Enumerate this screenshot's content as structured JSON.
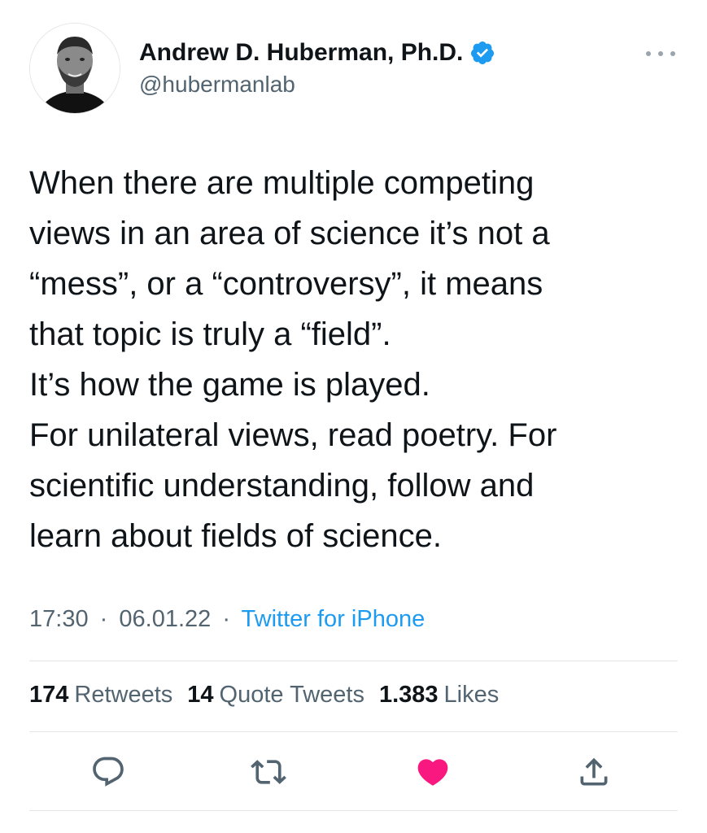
{
  "author": {
    "display_name": "Andrew D. Huberman, Ph.D.",
    "handle": "@hubermanlab",
    "verified": true
  },
  "tweet": {
    "lines": [
      "When there are multiple competing",
      "views in an area of science it’s not a",
      "“mess”, or a “controversy”, it means",
      "that topic is truly a “field”.",
      "It’s how the game is played.",
      "For unilateral views, read poetry. For",
      "scientific understanding, follow and",
      "learn about fields of science."
    ],
    "time": "17:30",
    "date": "06.01.22",
    "separator": "·",
    "source": "Twitter for iPhone"
  },
  "stats": {
    "retweets": {
      "count": "174",
      "label": "Retweets"
    },
    "quote_tweets": {
      "count": "14",
      "label": "Quote Tweets"
    },
    "likes": {
      "count": "1.383",
      "label": "Likes"
    }
  },
  "actions": {
    "icons": [
      "reply-icon",
      "retweet-icon",
      "like-icon",
      "share-icon"
    ],
    "liked": true
  },
  "colors": {
    "accent": "#1d9bf0",
    "like": "#f91880",
    "text": "#0f1419",
    "secondary": "#536471",
    "verified": "#1d9bf0"
  }
}
